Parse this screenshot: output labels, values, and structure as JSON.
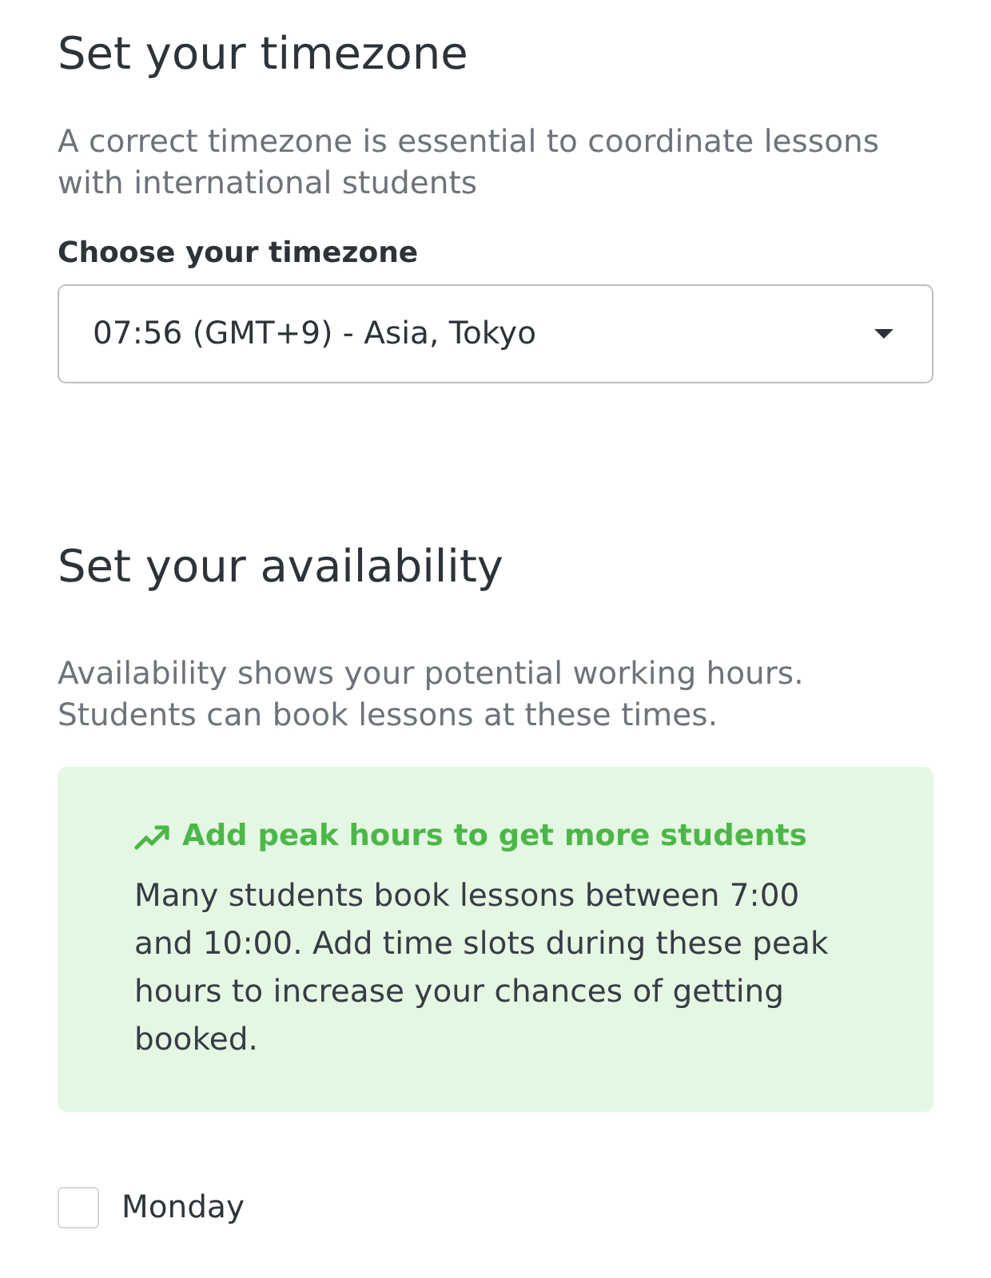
{
  "timezone_section": {
    "title": "Set your timezone",
    "description": "A correct timezone is essential to coordinate lessons with international students",
    "field_label": "Choose your timezone",
    "select": {
      "value": "07:56 (GMT+9) - Asia, Tokyo"
    }
  },
  "availability_section": {
    "title": "Set your availability",
    "description": "Availability shows your potential working hours. Students can book lessons at these times.",
    "tip": {
      "title": "Add peak hours to get more students",
      "body": "Many students book lessons between 7:00 and 10:00. Add time slots during these peak hours to increase your chances of getting booked."
    },
    "days": [
      {
        "label": "Monday",
        "checked": false
      }
    ]
  }
}
